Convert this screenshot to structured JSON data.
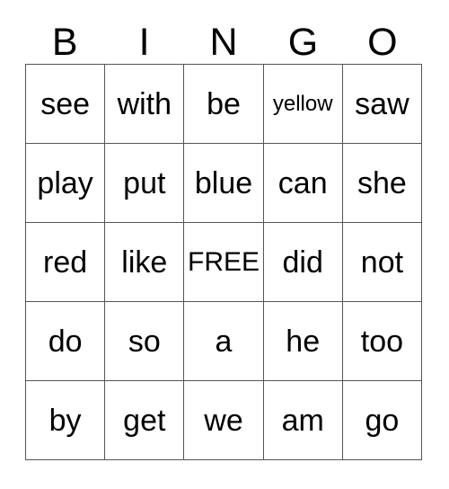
{
  "card": {
    "header": {
      "letters": [
        "B",
        "I",
        "N",
        "G",
        "O"
      ]
    },
    "grid": {
      "rows": [
        {
          "cells": [
            {
              "text": "see",
              "size": "normal",
              "free": false
            },
            {
              "text": "with",
              "size": "normal",
              "free": false
            },
            {
              "text": "be",
              "size": "normal",
              "free": false
            },
            {
              "text": "yellow",
              "size": "small",
              "free": false
            },
            {
              "text": "saw",
              "size": "normal",
              "free": false
            }
          ]
        },
        {
          "cells": [
            {
              "text": "play",
              "size": "normal",
              "free": false
            },
            {
              "text": "put",
              "size": "normal",
              "free": false
            },
            {
              "text": "blue",
              "size": "normal",
              "free": false
            },
            {
              "text": "can",
              "size": "normal",
              "free": false
            },
            {
              "text": "she",
              "size": "normal",
              "free": false
            }
          ]
        },
        {
          "cells": [
            {
              "text": "red",
              "size": "normal",
              "free": false
            },
            {
              "text": "like",
              "size": "normal",
              "free": false
            },
            {
              "text": "FREE",
              "size": "medium",
              "free": true
            },
            {
              "text": "did",
              "size": "normal",
              "free": false
            },
            {
              "text": "not",
              "size": "normal",
              "free": false
            }
          ]
        },
        {
          "cells": [
            {
              "text": "do",
              "size": "normal",
              "free": false
            },
            {
              "text": "so",
              "size": "normal",
              "free": false
            },
            {
              "text": "a",
              "size": "normal",
              "free": false
            },
            {
              "text": "he",
              "size": "normal",
              "free": false
            },
            {
              "text": "too",
              "size": "normal",
              "free": false
            }
          ]
        },
        {
          "cells": [
            {
              "text": "by",
              "size": "normal",
              "free": false
            },
            {
              "text": "get",
              "size": "normal",
              "free": false
            },
            {
              "text": "we",
              "size": "normal",
              "free": false
            },
            {
              "text": "am",
              "size": "normal",
              "free": false
            },
            {
              "text": "go",
              "size": "normal",
              "free": false
            }
          ]
        }
      ]
    },
    "colors": {
      "background": "#ffffff",
      "text": "#000000",
      "grid_line": "#555555"
    }
  }
}
